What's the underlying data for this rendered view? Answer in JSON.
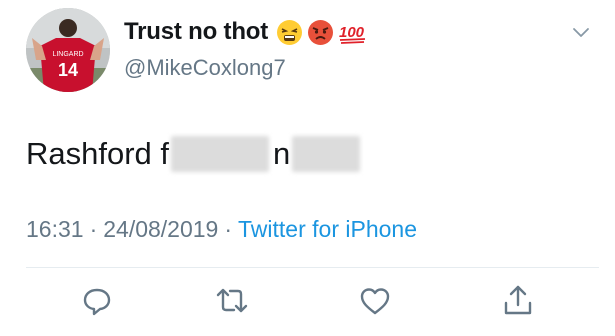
{
  "user": {
    "display_name": "Trust no thot",
    "handle": "@MikeCoxlong7",
    "name_emojis": [
      "tired-face-emoji",
      "angry-face-emoji",
      "hundred-points-emoji"
    ],
    "avatar_jersey_name": "LINGARD",
    "avatar_jersey_number": "14"
  },
  "tweet": {
    "text_part1": "Rashford f",
    "text_part2": "n",
    "time": "16:31",
    "separator": "·",
    "date": "24/08/2019",
    "source": "Twitter for iPhone"
  },
  "actions": [
    {
      "name": "reply-icon"
    },
    {
      "name": "retweet-icon"
    },
    {
      "name": "like-icon"
    },
    {
      "name": "share-icon"
    }
  ],
  "colors": {
    "text": "#14171a",
    "secondary": "#657786",
    "link": "#1b95e0",
    "divider": "#e6ecf0",
    "jersey": "#c8102e"
  }
}
